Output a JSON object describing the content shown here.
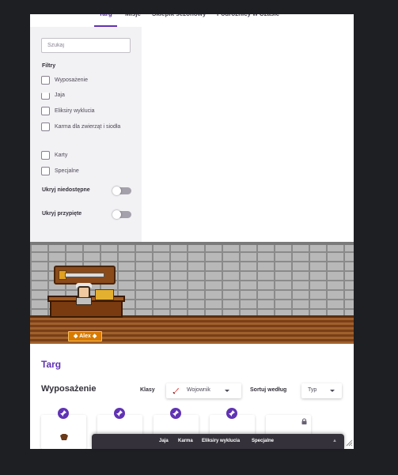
{
  "tabs": [
    {
      "label": "Targ",
      "active": true
    },
    {
      "label": "Misje",
      "active": false
    },
    {
      "label": "Sklepik sezonowy",
      "active": false
    },
    {
      "label": "Podróżnicy w Czasie",
      "active": false
    }
  ],
  "sidebar": {
    "search_placeholder": "Szukaj",
    "filters_title": "Filtry",
    "filters": [
      {
        "label": "Wyposażenie",
        "checked": false
      },
      {
        "label": "Jaja",
        "checked": false
      },
      {
        "label": "Eliksiry wyklucia",
        "checked": false
      },
      {
        "label": "Karma dla zwierząt i siodła",
        "checked": false
      },
      {
        "label": "Karty",
        "checked": false
      },
      {
        "label": "Specjalne",
        "checked": false
      }
    ],
    "toggles": [
      {
        "label": "Ukryj niedostępne",
        "on": false
      },
      {
        "label": "Ukryj przypięte",
        "on": false
      }
    ]
  },
  "banner": {
    "npc_name": "Alex"
  },
  "main": {
    "title": "Targ",
    "section_title": "Wyposażenie",
    "class_label": "Klasy",
    "class_value": "Wojownik",
    "sort_label": "Sortuj według",
    "sort_value": "Typ"
  },
  "items": [
    {
      "pinned": true,
      "locked": false
    },
    {
      "pinned": true,
      "locked": false
    },
    {
      "pinned": true,
      "locked": false
    },
    {
      "pinned": true,
      "locked": false
    },
    {
      "pinned": false,
      "locked": true
    }
  ],
  "drawer": {
    "tabs": [
      "Jaja",
      "Karma",
      "Eliksiry wyklucia",
      "Specjalne"
    ]
  },
  "colors": {
    "accent": "#6133b4",
    "tag": "#d97a00",
    "drawer": "#34313a"
  }
}
